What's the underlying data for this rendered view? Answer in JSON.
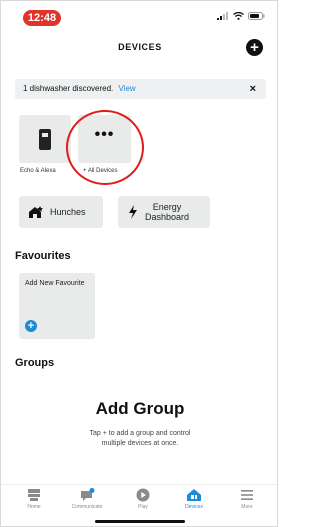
{
  "status_bar": {
    "time": "12:48"
  },
  "header": {
    "title": "DEVICES",
    "add_label": "+"
  },
  "banner": {
    "message": "1 dishwasher discovered.",
    "link": "View",
    "close": "×"
  },
  "device_tiles": [
    {
      "label": "Echo & Alexa",
      "icon": "echo-device-icon"
    },
    {
      "label": "+ All Devices",
      "icon": "more-dots-icon",
      "glyph": "•••"
    }
  ],
  "chips": {
    "hunches": "Hunches",
    "energy_line1": "Energy",
    "energy_line2": "Dashboard"
  },
  "favourites": {
    "title": "Favourites",
    "card_label": "Add New Favourite",
    "add_glyph": "+"
  },
  "groups": {
    "title": "Groups",
    "add_title": "Add Group",
    "description_line1": "Tap + to add a group and control",
    "description_line2": "multiple devices at once."
  },
  "bottom_nav": {
    "items": [
      {
        "label": "Home",
        "icon": "home-icon",
        "active": false
      },
      {
        "label": "Communicate",
        "icon": "chat-bubble-icon",
        "active": false
      },
      {
        "label": "Play",
        "icon": "play-icon",
        "active": false
      },
      {
        "label": "Devices",
        "icon": "devices-icon",
        "active": true
      },
      {
        "label": "More",
        "icon": "menu-icon",
        "active": false
      }
    ]
  },
  "colors": {
    "accent": "#1b8cd6",
    "time_pill": "#e0342b",
    "highlight_circle": "#e31b1b",
    "tile_bg": "#e9eaea"
  }
}
